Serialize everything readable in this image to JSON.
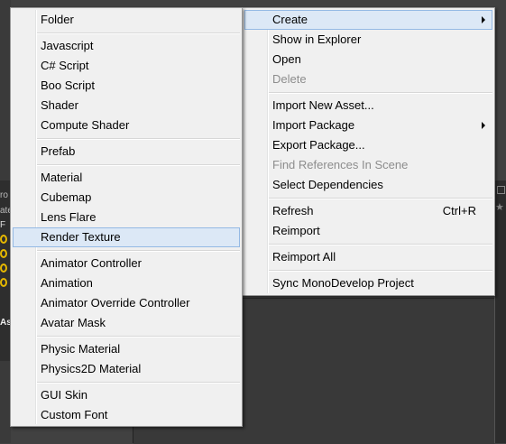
{
  "context_menu": {
    "items": [
      {
        "label": "Create",
        "highlighted": true,
        "submenu": true
      },
      {
        "label": "Show in Explorer"
      },
      {
        "label": "Open"
      },
      {
        "label": "Delete",
        "disabled": true
      },
      {
        "label": "Import New Asset..."
      },
      {
        "label": "Import Package",
        "submenu": true
      },
      {
        "label": "Export Package..."
      },
      {
        "label": "Find References In Scene",
        "disabled": true
      },
      {
        "label": "Select Dependencies"
      },
      {
        "label": "Refresh",
        "shortcut": "Ctrl+R"
      },
      {
        "label": "Reimport"
      },
      {
        "label": "Reimport All"
      },
      {
        "label": "Sync MonoDevelop Project"
      }
    ]
  },
  "create_submenu": {
    "items": [
      {
        "label": "Folder"
      },
      {
        "label": "Javascript"
      },
      {
        "label": "C# Script"
      },
      {
        "label": "Boo Script"
      },
      {
        "label": "Shader"
      },
      {
        "label": "Compute Shader"
      },
      {
        "label": "Prefab"
      },
      {
        "label": "Material"
      },
      {
        "label": "Cubemap"
      },
      {
        "label": "Lens Flare"
      },
      {
        "label": "Render Texture",
        "highlighted": true
      },
      {
        "label": "Animator Controller"
      },
      {
        "label": "Animation"
      },
      {
        "label": "Animator Override Controller"
      },
      {
        "label": "Avatar Mask"
      },
      {
        "label": "Physic Material"
      },
      {
        "label": "Physics2D Material"
      },
      {
        "label": "GUI Skin"
      },
      {
        "label": "Custom Font"
      }
    ]
  },
  "background": {
    "side_labels": [
      "ro",
      "ate",
      "F",
      "As"
    ]
  },
  "colors": {
    "menu_bg": "#f0f0f0",
    "highlight_bg": "#dce8f6",
    "highlight_border": "#94b9e4",
    "disabled_text": "#8d8d8d",
    "editor_bg": "#414141"
  }
}
